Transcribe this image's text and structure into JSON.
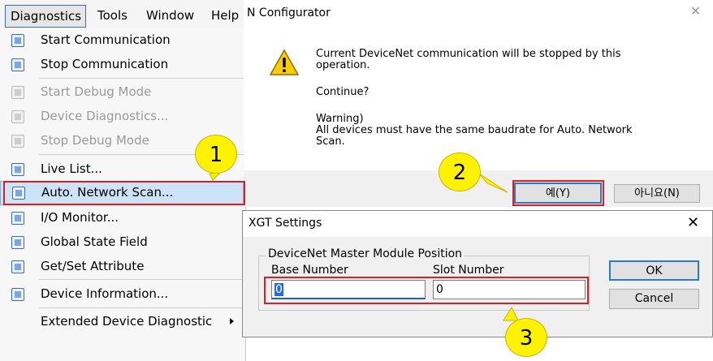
{
  "menubar": {
    "items": [
      "Diagnostics",
      "Tools",
      "Window",
      "Help"
    ]
  },
  "menu": {
    "items": [
      {
        "label": "Start Communication",
        "enabled": true,
        "icon": "start-communication-icon"
      },
      {
        "label": "Stop Communication",
        "enabled": true,
        "icon": "stop-communication-icon"
      },
      {
        "label": "Start Debug Mode",
        "enabled": false,
        "icon": "start-debug-icon"
      },
      {
        "label": "Device Diagnostics...",
        "enabled": false,
        "icon": "device-diagnostics-icon"
      },
      {
        "label": "Stop Debug Mode",
        "enabled": false,
        "icon": "stop-debug-icon"
      },
      {
        "label": "Live List...",
        "enabled": true,
        "icon": "live-list-icon"
      },
      {
        "label": "Auto. Network Scan...",
        "enabled": true,
        "icon": "network-scan-icon"
      },
      {
        "label": "I/O Monitor...",
        "enabled": true,
        "icon": "io-monitor-icon"
      },
      {
        "label": "Global State Field",
        "enabled": true,
        "icon": "global-state-icon"
      },
      {
        "label": "Get/Set Attribute",
        "enabled": true,
        "icon": "attribute-icon"
      },
      {
        "label": "Device Information...",
        "enabled": true,
        "icon": "device-info-icon"
      },
      {
        "label": "Extended Device Diagnostic",
        "enabled": true,
        "icon": "submenu-arrow-icon"
      }
    ]
  },
  "configurator": {
    "title": "N Configurator",
    "close": "✕",
    "message_line1": "Current DeviceNet communication will be stopped by this",
    "message_line2": "operation.",
    "continue": "Continue?",
    "warning_title": "Warning)",
    "warning_line1": "All devices must have the same baudrate for Auto. Network",
    "warning_line2": "Scan.",
    "yes_label": "예(Y)",
    "no_label": "아니요(N)"
  },
  "xgt": {
    "title": "XGT Settings",
    "close": "✕",
    "group_label": "DeviceNet Master Module Position",
    "base_label": "Base Number",
    "slot_label": "Slot Number",
    "base_value": "0",
    "slot_value": "0",
    "ok_label": "OK",
    "cancel_label": "Cancel"
  },
  "annotations": {
    "step1": "1",
    "step2": "2",
    "step3": "3",
    "highlight_color": "#e01b24",
    "badge_color": "#fff200"
  }
}
